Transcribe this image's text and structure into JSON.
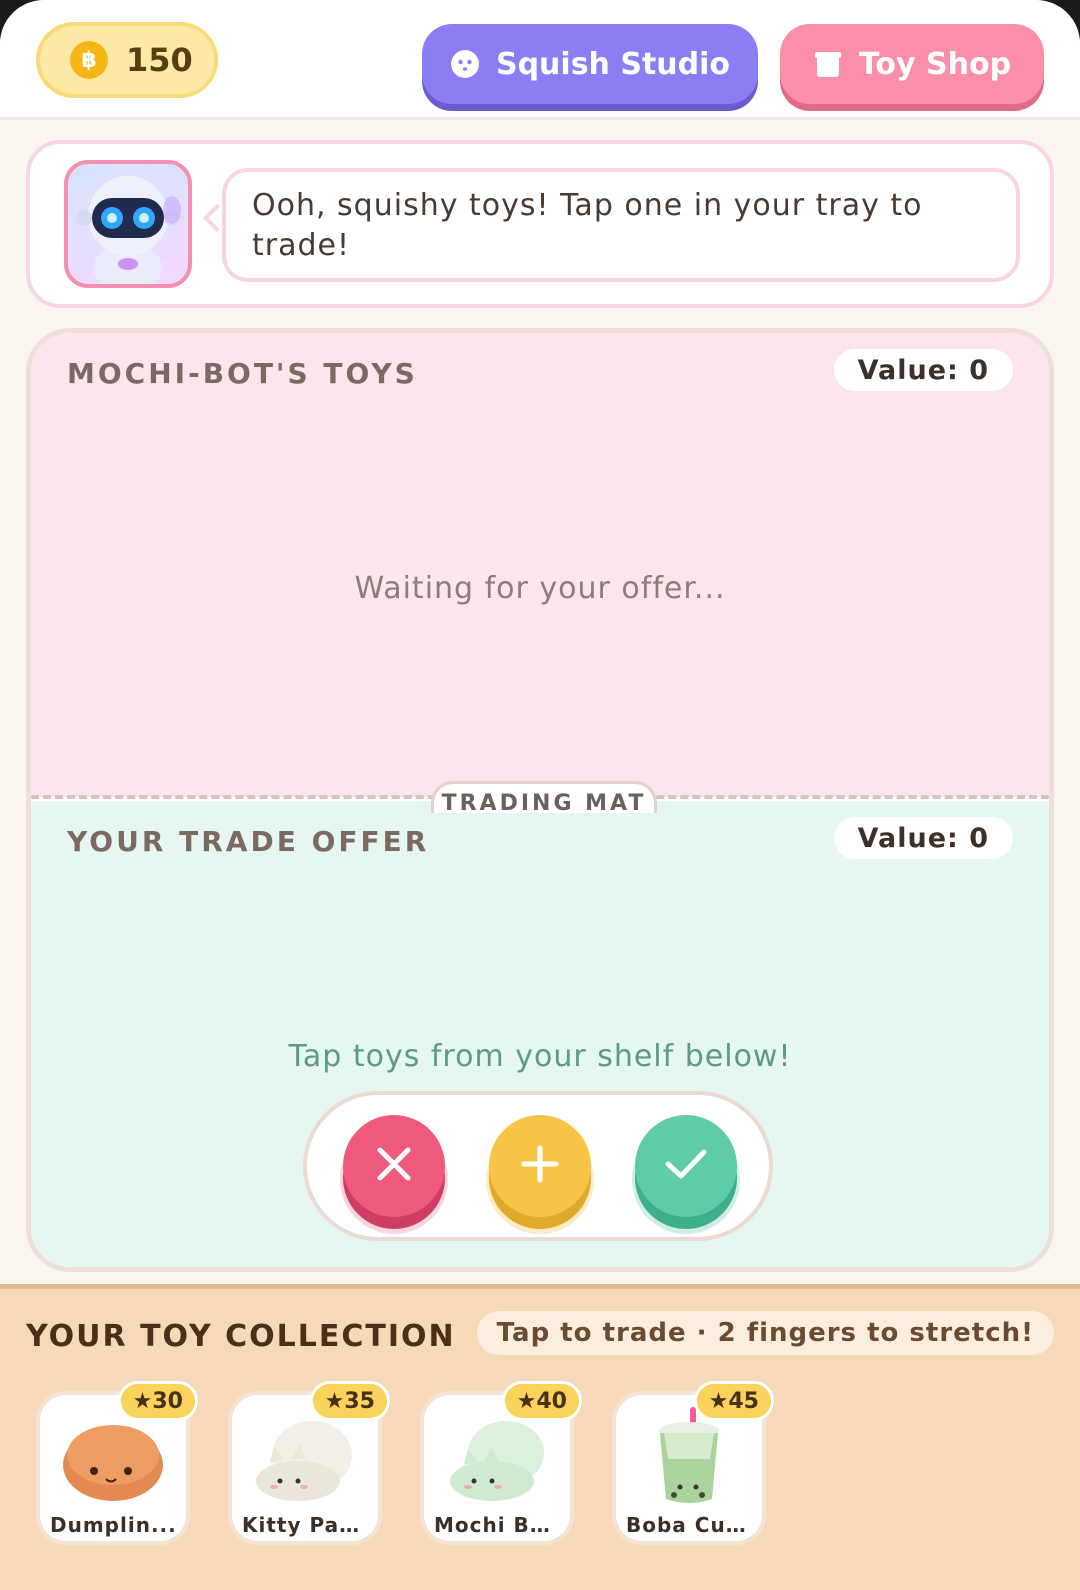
{
  "header": {
    "coins": "150",
    "coin_symbol": "฿",
    "studio_label": "Squish Studio",
    "shop_label": "Toy Shop"
  },
  "message": {
    "text": "Ooh, squishy toys! Tap one in your tray to trade!"
  },
  "bot_zone": {
    "title": "MOCHI-BOT'S TOYS",
    "value_label": "Value: 0",
    "hint": "Waiting for your offer..."
  },
  "mat_label": "TRADING MAT",
  "offer_zone": {
    "title": "YOUR TRADE OFFER",
    "value_label": "Value: 0",
    "hint": "Tap toys from your shelf below!"
  },
  "actions": {
    "cancel_icon": "close-icon",
    "add_icon": "plus-icon",
    "confirm_icon": "check-icon"
  },
  "collection": {
    "title": "YOUR TOY COLLECTION",
    "hint": "Tap to trade · 2 fingers to stretch!",
    "toys": [
      {
        "name": "Dumplin...",
        "value": "★30"
      },
      {
        "name": "Kitty Paw...",
        "value": "★35"
      },
      {
        "name": "Mochi Bu...",
        "value": "★40"
      },
      {
        "name": "Boba Cup...",
        "value": "★45"
      }
    ]
  },
  "colors": {
    "studio": "#8b7df3",
    "shop": "#fb8ea9",
    "cancel": "#ef5a7c",
    "add": "#f8c445",
    "confirm": "#5fcba9"
  }
}
